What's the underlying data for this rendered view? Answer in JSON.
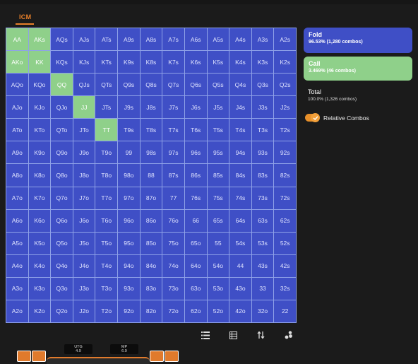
{
  "header": {
    "tab_label": "ICM"
  },
  "grid": {
    "rows": [
      [
        "AA",
        "AKs",
        "AQs",
        "AJs",
        "ATs",
        "A9s",
        "A8s",
        "A7s",
        "A6s",
        "A5s",
        "A4s",
        "A3s",
        "A2s"
      ],
      [
        "AKo",
        "KK",
        "KQs",
        "KJs",
        "KTs",
        "K9s",
        "K8s",
        "K7s",
        "K6s",
        "K5s",
        "K4s",
        "K3s",
        "K2s"
      ],
      [
        "AQo",
        "KQo",
        "QQ",
        "QJs",
        "QTs",
        "Q9s",
        "Q8s",
        "Q7s",
        "Q6s",
        "Q5s",
        "Q4s",
        "Q3s",
        "Q2s"
      ],
      [
        "AJo",
        "KJo",
        "QJo",
        "JJ",
        "JTs",
        "J9s",
        "J8s",
        "J7s",
        "J6s",
        "J5s",
        "J4s",
        "J3s",
        "J2s"
      ],
      [
        "ATo",
        "KTo",
        "QTo",
        "JTo",
        "TT",
        "T9s",
        "T8s",
        "T7s",
        "T6s",
        "T5s",
        "T4s",
        "T3s",
        "T2s"
      ],
      [
        "A9o",
        "K9o",
        "Q9o",
        "J9o",
        "T9o",
        "99",
        "98s",
        "97s",
        "96s",
        "95s",
        "94s",
        "93s",
        "92s"
      ],
      [
        "A8o",
        "K8o",
        "Q8o",
        "J8o",
        "T8o",
        "98o",
        "88",
        "87s",
        "86s",
        "85s",
        "84s",
        "83s",
        "82s"
      ],
      [
        "A7o",
        "K7o",
        "Q7o",
        "J7o",
        "T7o",
        "97o",
        "87o",
        "77",
        "76s",
        "75s",
        "74s",
        "73s",
        "72s"
      ],
      [
        "A6o",
        "K6o",
        "Q6o",
        "J6o",
        "T6o",
        "96o",
        "86o",
        "76o",
        "66",
        "65s",
        "64s",
        "63s",
        "62s"
      ],
      [
        "A5o",
        "K5o",
        "Q5o",
        "J5o",
        "T5o",
        "95o",
        "85o",
        "75o",
        "65o",
        "55",
        "54s",
        "53s",
        "52s"
      ],
      [
        "A4o",
        "K4o",
        "Q4o",
        "J4o",
        "T4o",
        "94o",
        "84o",
        "74o",
        "64o",
        "54o",
        "44",
        "43s",
        "42s"
      ],
      [
        "A3o",
        "K3o",
        "Q3o",
        "J3o",
        "T3o",
        "93o",
        "83o",
        "73o",
        "63o",
        "53o",
        "43o",
        "33",
        "32s"
      ],
      [
        "A2o",
        "K2o",
        "Q2o",
        "J2o",
        "T2o",
        "92o",
        "82o",
        "72o",
        "62o",
        "52o",
        "42o",
        "32o",
        "22"
      ]
    ],
    "call_hands": [
      "AA",
      "AKs",
      "AKo",
      "KK",
      "QQ",
      "JJ",
      "TT"
    ]
  },
  "actions": {
    "fold": {
      "title": "Fold",
      "detail": "96.53% (1,280 combos)"
    },
    "call": {
      "title": "Call",
      "detail": "3.469% (46 combos)"
    }
  },
  "total": {
    "label": "Total",
    "detail": "100.0% (1,326 combos)"
  },
  "relative_combos": {
    "label": "Relative Combos",
    "enabled": true
  },
  "seats": [
    {
      "name": "UTG",
      "stack": "4.9"
    },
    {
      "name": "MP",
      "stack": "6.9"
    }
  ],
  "colors": {
    "fold": "#3f4fc6",
    "call": "#8fd08a",
    "accent": "#e8802a"
  },
  "toolbar_icons": [
    "list-icon",
    "table-icon",
    "sort-icon",
    "chips-icon"
  ]
}
